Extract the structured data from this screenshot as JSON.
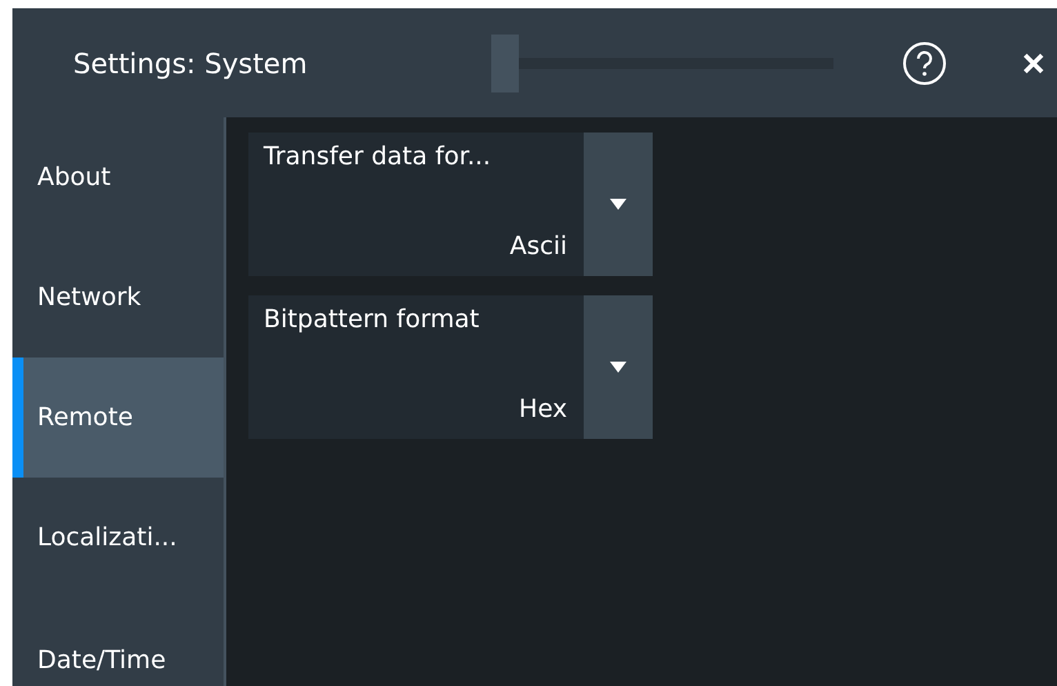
{
  "window": {
    "title": "Settings: System"
  },
  "sidebar": {
    "items": [
      {
        "label": "About",
        "selected": false
      },
      {
        "label": "Network",
        "selected": false
      },
      {
        "label": "Remote",
        "selected": true
      },
      {
        "label": "Localizati...",
        "selected": false
      },
      {
        "label": "Date/Time",
        "selected": false
      }
    ]
  },
  "settings": [
    {
      "label": "Transfer data for...",
      "value": "Ascii"
    },
    {
      "label": "Bitpattern format",
      "value": "Hex"
    }
  ]
}
